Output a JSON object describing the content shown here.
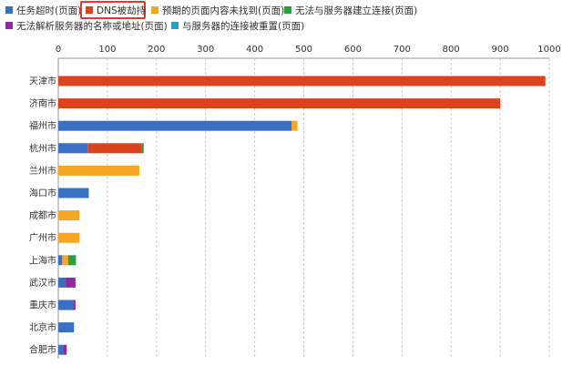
{
  "chart_data": {
    "type": "bar",
    "orientation": "horizontal",
    "stacked": true,
    "categories": [
      "天津市",
      "济南市",
      "福州市",
      "杭州市",
      "兰州市",
      "海口市",
      "成都市",
      "广州市",
      "上海市",
      "武汉市",
      "重庆市",
      "北京市",
      "合肥市"
    ],
    "series": [
      {
        "name": "任务超时(页面)",
        "color": "#3a6fc4",
        "values": [
          0,
          0,
          475,
          60,
          0,
          62,
          0,
          0,
          8,
          15,
          30,
          32,
          10
        ]
      },
      {
        "name": "DNS被劫持",
        "color": "#d9441f",
        "values": [
          992,
          900,
          0,
          110,
          0,
          0,
          0,
          0,
          0,
          0,
          0,
          0,
          0
        ]
      },
      {
        "name": "预期的页面内容未找到(页面)",
        "color": "#f5a623",
        "values": [
          0,
          0,
          12,
          0,
          165,
          0,
          43,
          43,
          12,
          0,
          0,
          0,
          0
        ]
      },
      {
        "name": "无法与服务器建立连接(页面)",
        "color": "#2e9e3e",
        "values": [
          0,
          0,
          0,
          4,
          0,
          0,
          0,
          0,
          16,
          0,
          0,
          0,
          0
        ]
      },
      {
        "name": "无法解析服务器的名称或地址(页面)",
        "color": "#8e2a9e",
        "values": [
          0,
          0,
          0,
          0,
          0,
          0,
          0,
          0,
          0,
          20,
          5,
          0,
          7
        ]
      },
      {
        "name": "与服务器的连接被重置(页面)",
        "color": "#2a9fc0",
        "values": [
          0,
          0,
          0,
          0,
          0,
          0,
          0,
          0,
          0,
          0,
          0,
          0,
          0
        ]
      }
    ],
    "xlim": [
      0,
      1000
    ],
    "xticks": [
      0,
      100,
      200,
      300,
      400,
      500,
      600,
      700,
      800,
      900,
      1000
    ],
    "grid": true,
    "legend_position": "top",
    "highlighted_legend": "DNS被劫持"
  }
}
